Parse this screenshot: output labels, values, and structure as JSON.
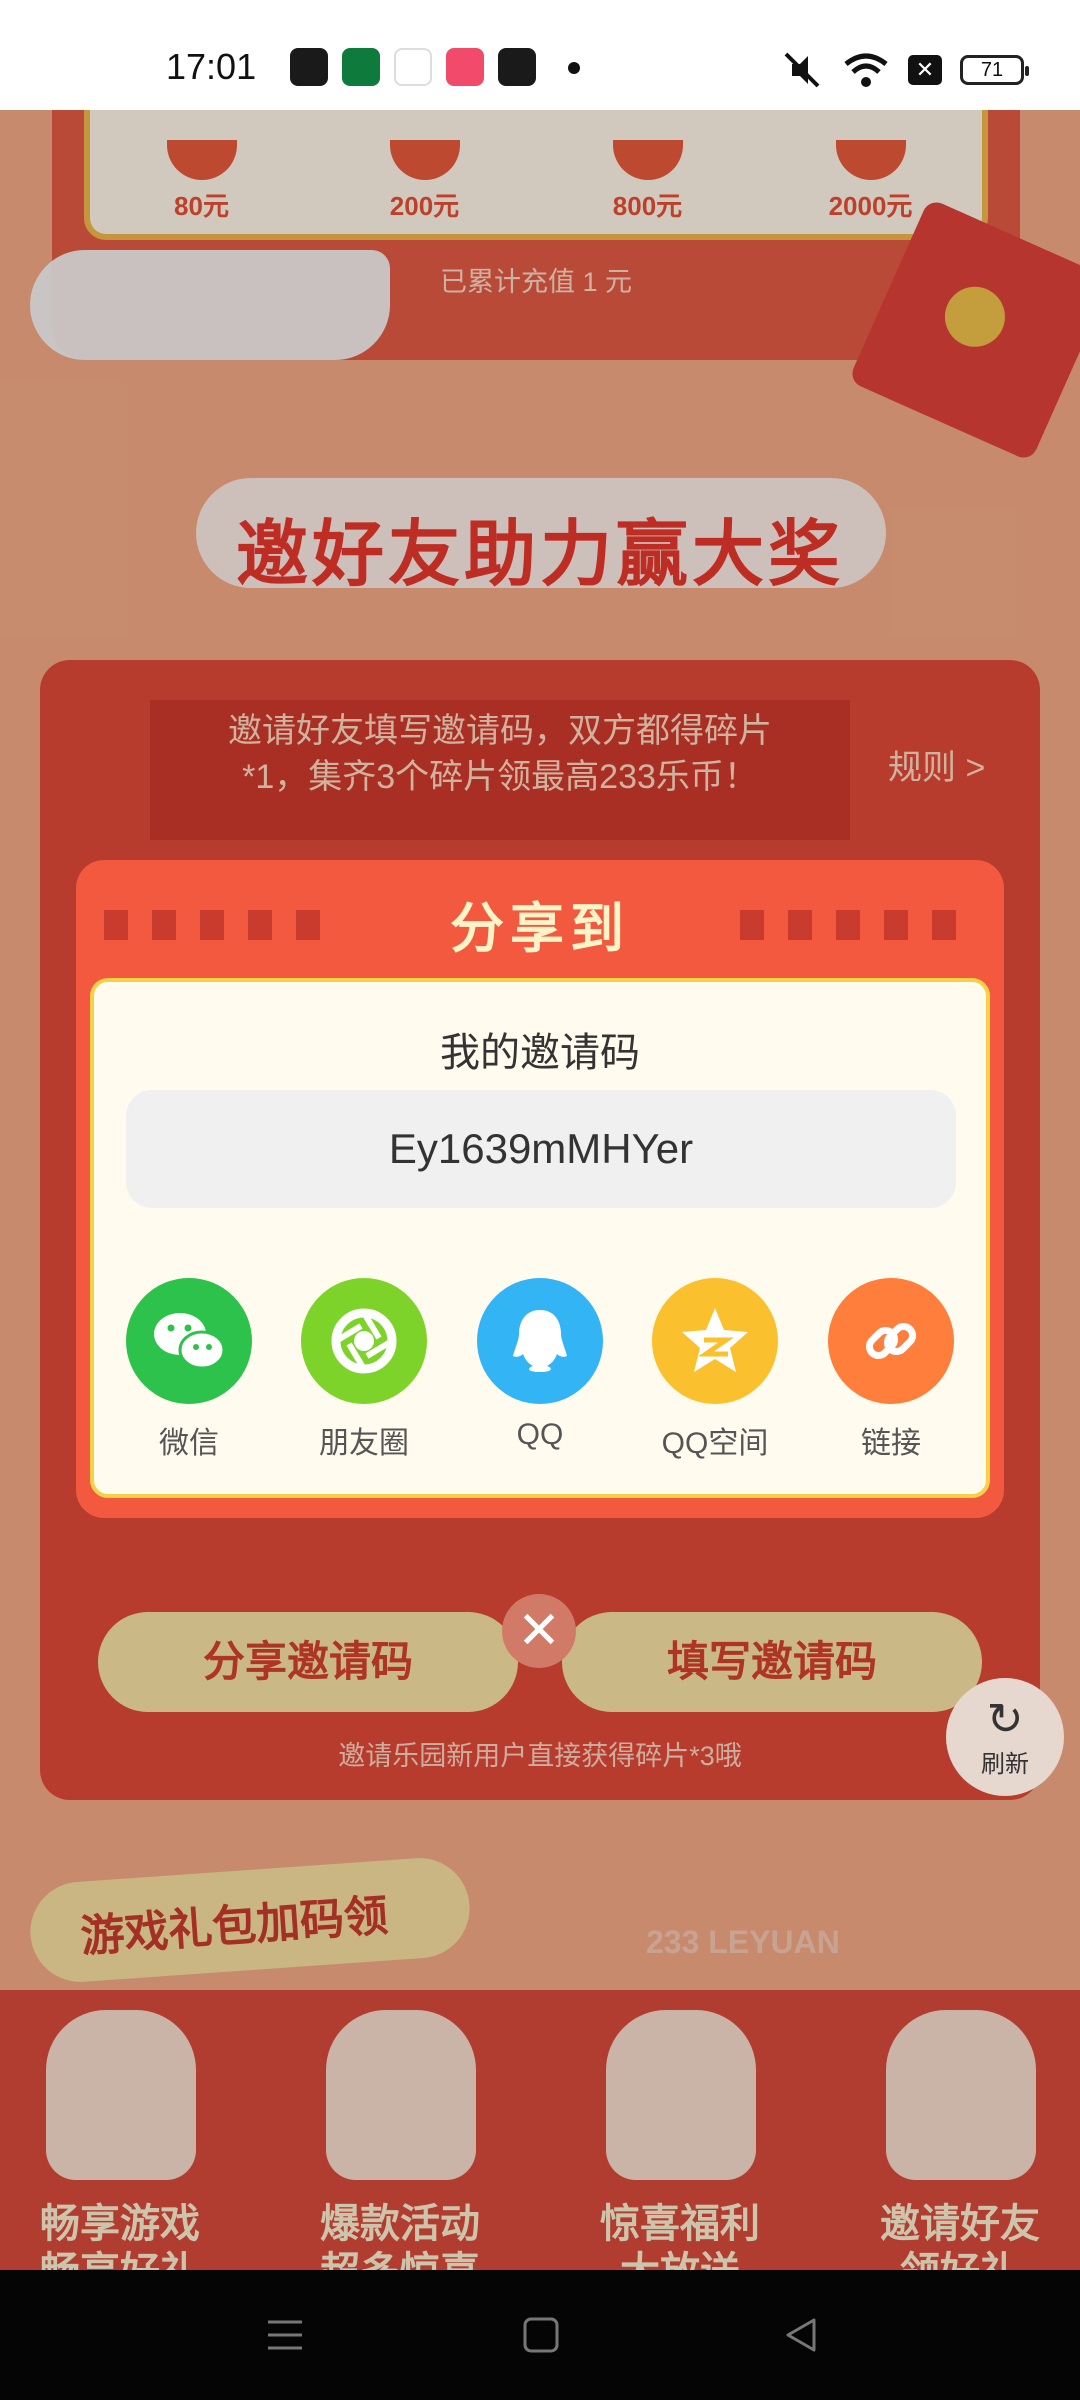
{
  "status_bar": {
    "time": "17:01",
    "battery": "71"
  },
  "background": {
    "rewards": [
      "80元",
      "200元",
      "800元",
      "2000元"
    ],
    "recharge_note": "已累计充值 1 元",
    "banner_title": "邀好友助力赢大奖",
    "invite_desc_line1": "邀请好友填写邀请码，双方都得碎片",
    "invite_desc_line2": "*1，集齐3个碎片领最高233乐币！",
    "rules_label": "规则 >",
    "share_code_button": "分享邀请码",
    "fill_code_button": "填写邀请码",
    "invite_note": "邀请乐园新用户直接获得碎片*3哦",
    "refresh_label": "刷新",
    "gift_title": "游戏礼包加码领",
    "leyuan_label": "233 LEYUAN",
    "gift_items": [
      {
        "line1": "畅享游戏",
        "line2": "畅享好礼"
      },
      {
        "line1": "爆款活动",
        "line2": "超多惊喜"
      },
      {
        "line1": "惊喜福利",
        "line2": "大放送"
      },
      {
        "line1": "邀请好友",
        "line2": "领好礼"
      }
    ]
  },
  "dialog": {
    "title": "分享到",
    "code_label": "我的邀请码",
    "invite_code": "Ey1639mMHYer",
    "share_options": [
      {
        "label": "微信",
        "icon": "wechat-icon",
        "color": "#2dc24c"
      },
      {
        "label": "朋友圈",
        "icon": "moments-icon",
        "color": "#7ed32a"
      },
      {
        "label": "QQ",
        "icon": "qq-icon",
        "color": "#32b4f5"
      },
      {
        "label": "QQ空间",
        "icon": "qzone-icon",
        "color": "#fbc02d"
      },
      {
        "label": "链接",
        "icon": "link-icon",
        "color": "#ff7e3c"
      }
    ],
    "close_icon": "close-icon"
  }
}
